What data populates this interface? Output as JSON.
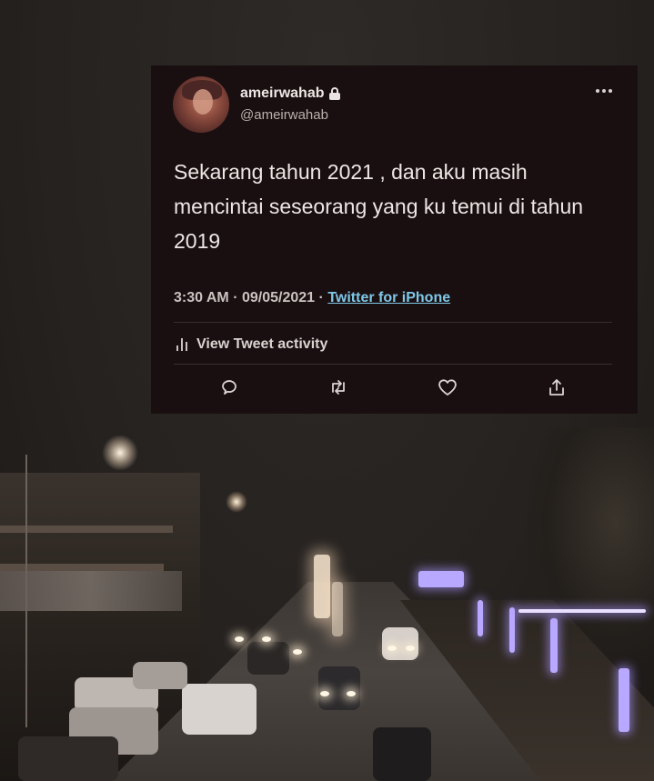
{
  "tweet": {
    "display_name": "ameirwahab",
    "handle": "@ameirwahab",
    "text": "Sekarang tahun 2021 , dan aku masih mencintai seseorang yang ku temui di tahun 2019",
    "time": "3:30 AM",
    "date": "09/05/2021",
    "separator": "·",
    "source": "Twitter for iPhone",
    "activity_label": "View Tweet activity",
    "icons": {
      "verified_lock": "lock-icon",
      "more": "more-icon",
      "activity": "bar-chart-icon",
      "actions": [
        "reply-icon",
        "retweet-icon",
        "like-icon",
        "share-icon"
      ]
    }
  },
  "colors": {
    "card_background": "#1a0f10",
    "link": "#7ec8e8",
    "text": "#ece7e5"
  }
}
